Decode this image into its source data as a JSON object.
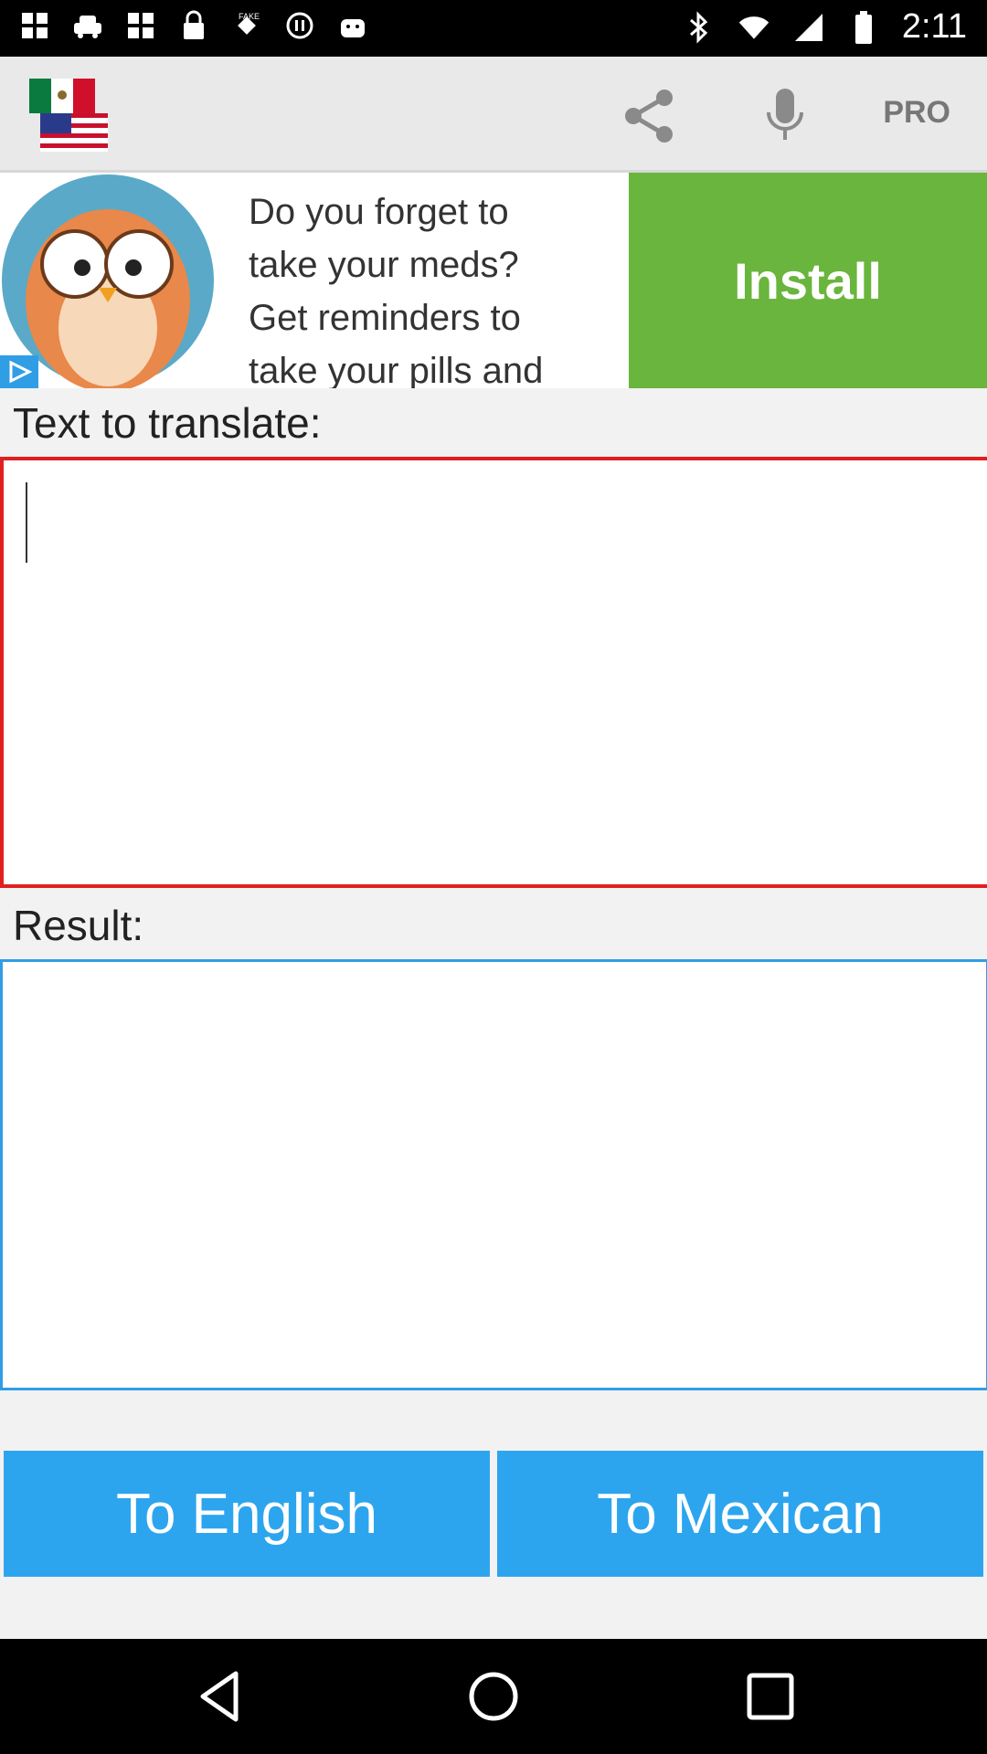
{
  "status_bar": {
    "time": "2:11",
    "left_icons": [
      "gallery-icon",
      "taxi-icon",
      "gallery-icon",
      "lock-icon",
      "fake-gps-icon",
      "circle-icon",
      "android-icon"
    ],
    "right_icons": [
      "bluetooth-icon",
      "wifi-icon",
      "signal-icon",
      "battery-icon"
    ]
  },
  "app_bar": {
    "pro_label": "PRO",
    "icons": [
      "flags-icon",
      "share-icon",
      "microphone-icon"
    ]
  },
  "ad": {
    "text": "Do you forget to\ntake your meds?\nGet reminders to\ntake your pills and",
    "install_label": "Install"
  },
  "input_section": {
    "label": "Text to translate:",
    "value": ""
  },
  "result_section": {
    "label": "Result:",
    "value": ""
  },
  "buttons": {
    "to_english": "To English",
    "to_mexican": "To Mexican"
  },
  "colors": {
    "accent": "#2da5ee",
    "input_border": "#e02020",
    "install_green": "#6ab53d"
  }
}
